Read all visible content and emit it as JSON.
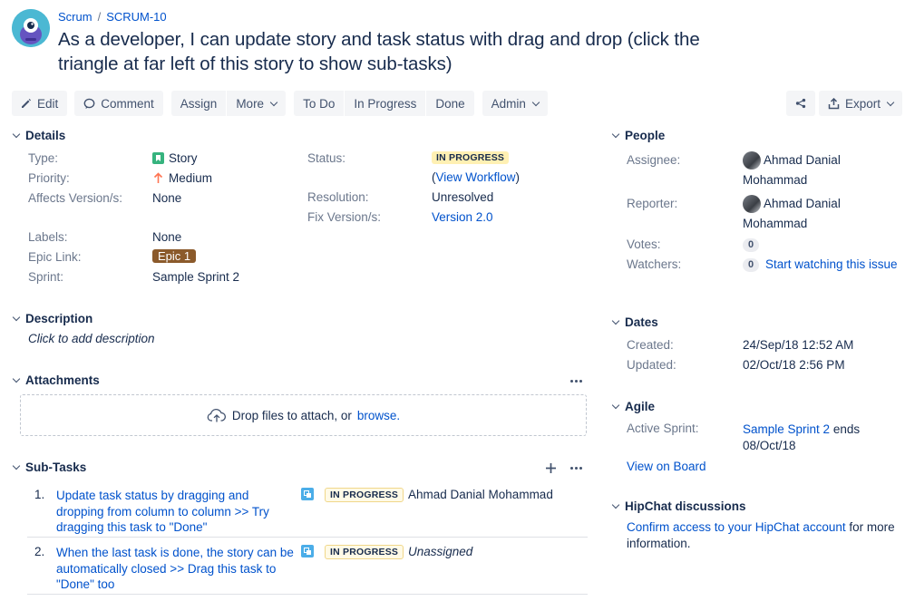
{
  "breadcrumbs": {
    "project": "Scrum",
    "separator": "/",
    "issue_key": "SCRUM-10"
  },
  "issue": {
    "title": "As a developer, I can update story and task status with drag and drop (click the triangle at far left of this story to show sub-tasks)"
  },
  "toolbar": {
    "edit": "Edit",
    "comment": "Comment",
    "assign": "Assign",
    "more": "More",
    "todo": "To Do",
    "in_progress": "In Progress",
    "done": "Done",
    "admin": "Admin",
    "export": "Export"
  },
  "details": {
    "heading": "Details",
    "type_label": "Type:",
    "type_value": "Story",
    "priority_label": "Priority:",
    "priority_value": "Medium",
    "affects_label": "Affects Version/s:",
    "affects_value": "None",
    "labels_label": "Labels:",
    "labels_value": "None",
    "epic_label": "Epic Link:",
    "epic_value": "Epic 1",
    "sprint_label": "Sprint:",
    "sprint_value": "Sample Sprint 2",
    "status_label": "Status:",
    "status_value": "IN PROGRESS",
    "workflow_open": "(",
    "workflow_link": "View Workflow",
    "workflow_close": ")",
    "resolution_label": "Resolution:",
    "resolution_value": "Unresolved",
    "fix_label": "Fix Version/s:",
    "fix_value": "Version 2.0"
  },
  "description": {
    "heading": "Description",
    "placeholder": "Click to add description"
  },
  "attachments": {
    "heading": "Attachments",
    "drop_text": "Drop files to attach, or",
    "browse": "browse."
  },
  "subtasks": {
    "heading": "Sub-Tasks",
    "items": [
      {
        "num": "1.",
        "lines": [
          "Update task status by dragging and",
          "dropping from column to column >> Try",
          "dragging this task to \"Done\""
        ],
        "status": "IN PROGRESS",
        "assignee": "Ahmad Danial Mohammad"
      },
      {
        "num": "2.",
        "lines": [
          "When the last task is done, the story can be",
          "automatically closed >> Drag this task to",
          "\"Done\" too"
        ],
        "status": "IN PROGRESS",
        "assignee": "Unassigned"
      }
    ]
  },
  "people": {
    "heading": "People",
    "assignee_label": "Assignee:",
    "assignee_name_1": "Ahmad Danial",
    "assignee_name_2": "Mohammad",
    "reporter_label": "Reporter:",
    "reporter_name_1": "Ahmad Danial",
    "reporter_name_2": "Mohammad",
    "votes_label": "Votes:",
    "votes_count": "0",
    "watchers_label": "Watchers:",
    "watchers_count": "0",
    "watch_link": "Start watching this issue"
  },
  "dates": {
    "heading": "Dates",
    "created_label": "Created:",
    "created_value": "24/Sep/18 12:52 AM",
    "updated_label": "Updated:",
    "updated_value": "02/Oct/18 2:56 PM"
  },
  "agile": {
    "heading": "Agile",
    "sprint_label": "Active Sprint:",
    "sprint_link": "Sample Sprint 2",
    "sprint_ends": "ends",
    "sprint_end_date": "08/Oct/18",
    "board_link": "View on Board"
  },
  "hipchat": {
    "heading": "HipChat discussions",
    "link": "Confirm access to your HipChat account",
    "text_after": "for more",
    "text_line2": "information."
  },
  "colors": {
    "link": "#0052cc",
    "text": "#172b4d",
    "muted": "#6b778c",
    "story_green": "#36b37e",
    "priority_orange": "#ff7452",
    "epic_brown": "#8b5a2b",
    "inprogress_bg": "#fff0b3",
    "subtask_blue": "#4bade8",
    "project_avatar": "#4bb8d3"
  }
}
